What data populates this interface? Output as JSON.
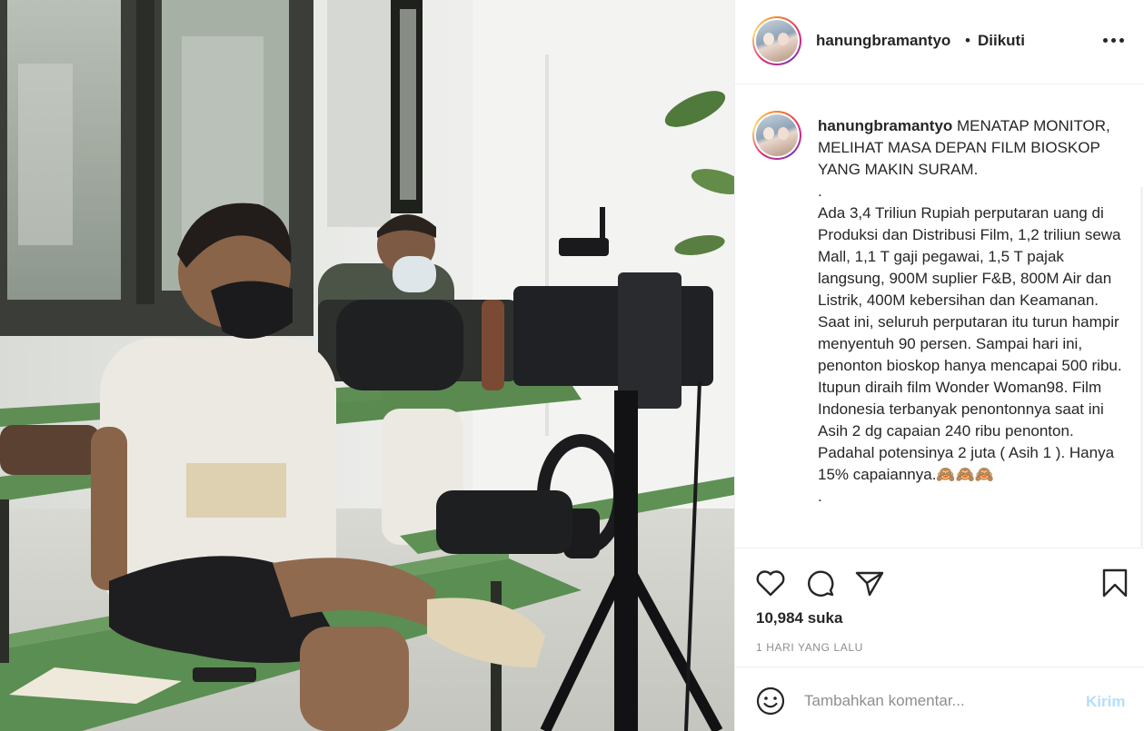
{
  "post": {
    "username": "hanungbramantyo",
    "follow_separator": "•",
    "follow_status": "Diikuti",
    "more_icon": "more-horizontal-icon",
    "caption_username": "hanungbramantyo",
    "caption_text": " MENATAP MONITOR, MELIHAT MASA DEPAN FILM BIOSKOP YANG MAKIN SURAM.\n.\nAda 3,4 Triliun Rupiah perputaran uang di Produksi dan Distribusi Film, 1,2 triliun sewa Mall, 1,1 T gaji pegawai, 1,5 T pajak langsung, 900M suplier F&B, 800M Air dan Listrik, 400M kebersihan dan Keamanan. Saat ini, seluruh perputaran itu turun hampir menyentuh 90 persen. Sampai hari ini, penonton bioskop hanya mencapai 500 ribu. Itupun diraih film Wonder Woman98. Film Indonesia terbanyak penontonnya saat ini Asih 2 dg capaian 240 ribu penonton. Padahal potensinya 2 juta ( Asih 1 ). Hanya 15% capaiannya.🙈🙈🙈\n.",
    "likes": "10,984 suka",
    "time": "1 HARI YANG LALU"
  },
  "actions": {
    "like_icon": "heart-icon",
    "comment_icon": "comment-icon",
    "share_icon": "paper-plane-icon",
    "save_icon": "bookmark-icon"
  },
  "comment": {
    "emoji_icon": "smiley-icon",
    "placeholder": "Tambahkan komentar...",
    "post_label": "Kirim"
  },
  "colors": {
    "link_disabled": "#b2dffc",
    "muted": "#8e8e8e",
    "text": "#262626"
  }
}
